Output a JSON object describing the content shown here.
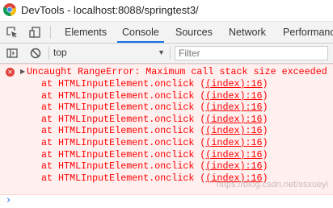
{
  "window": {
    "title": "DevTools - localhost:8088/springtest3/"
  },
  "tabs": [
    {
      "label": "Elements"
    },
    {
      "label": "Console",
      "active": true
    },
    {
      "label": "Sources"
    },
    {
      "label": "Network"
    },
    {
      "label": "Performanc"
    }
  ],
  "icons": {
    "inspect": "inspect-element-icon",
    "device": "device-toolbar-icon",
    "sidebar": "console-sidebar-icon",
    "clear": "clear-console-icon",
    "error": "error-icon",
    "expand": "expand-triangle-icon",
    "prompt": "prompt-chevron-icon"
  },
  "console_toolbar": {
    "context": "top",
    "filter_placeholder": "Filter"
  },
  "error": {
    "message": "Uncaught RangeError: Maximum call stack size exceeded",
    "stack_prefix": "at HTMLInputElement.onclick (",
    "stack_link": "(index):16",
    "stack_suffix": ")",
    "stack_count": 9
  },
  "watermark": "https://blog.csdn.net/ssxueyi",
  "colors": {
    "error_text": "#ff0000",
    "error_bg": "#fff0f0",
    "active_tab_underline": "#1a73e8"
  }
}
